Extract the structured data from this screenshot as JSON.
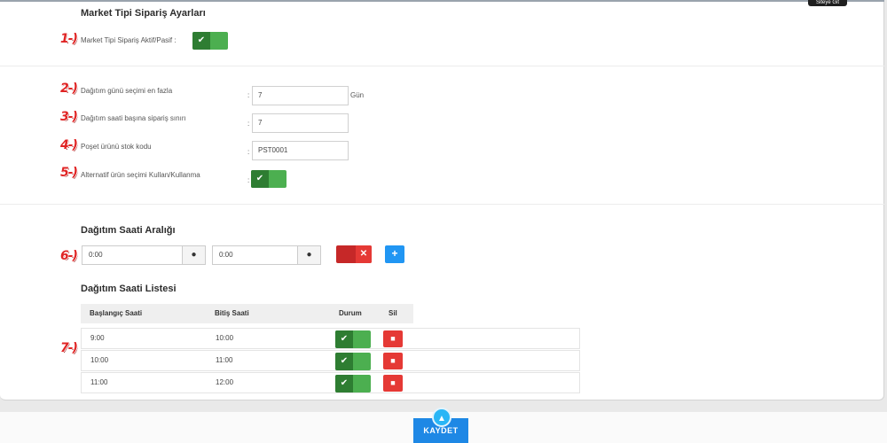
{
  "tooltip": {
    "label": "Siteye Git"
  },
  "market_section": {
    "title": "Market Tipi Sipariş Ayarları",
    "marker": "1-)",
    "toggle_label": "Market Tipi Sipariş Aktif/Pasif :",
    "toggle_state": "on"
  },
  "settings": {
    "fields": [
      {
        "marker": "2-)",
        "label": "Dağıtım günü seçimi en fazla",
        "value": "7",
        "unit": "Gün"
      },
      {
        "marker": "3-)",
        "label": "Dağıtım saati başına sipariş sınırı",
        "value": "7"
      },
      {
        "marker": "4-)",
        "label": "Poşet ürünü stok kodu",
        "value": "PST0001"
      }
    ],
    "alt_toggle": {
      "marker": "5-)",
      "label": "Alternatif ürün seçimi Kullan/Kullanma",
      "state": "on"
    },
    "colon": ":"
  },
  "range_section": {
    "title": "Dağıtım Saati Aralığı",
    "marker": "6-)",
    "start_value": "0:00",
    "end_value": "0:00",
    "clock_icon": "clock-icon",
    "remove_icon": "close-icon",
    "add_icon": "plus-icon",
    "remove_glyph": "✕",
    "add_glyph": "+"
  },
  "list_section": {
    "title": "Dağıtım Saati Listesi",
    "marker": "7-)",
    "columns": [
      "Başlangıç Saati",
      "Bitiş Saati",
      "Durum",
      "Sil"
    ],
    "rows": [
      {
        "start": "9:00",
        "end": "10:00",
        "status": "on"
      },
      {
        "start": "10:00",
        "end": "11:00",
        "status": "on"
      },
      {
        "start": "11:00",
        "end": "12:00",
        "status": "on"
      }
    ]
  },
  "footer": {
    "save_label": "KAYDET",
    "scroll_top_icon": "chevron-up-icon"
  },
  "colors": {
    "toggle_on": "#4caf50",
    "danger": "#e53935",
    "primary": "#1e88e5",
    "marker": "#e02424"
  }
}
